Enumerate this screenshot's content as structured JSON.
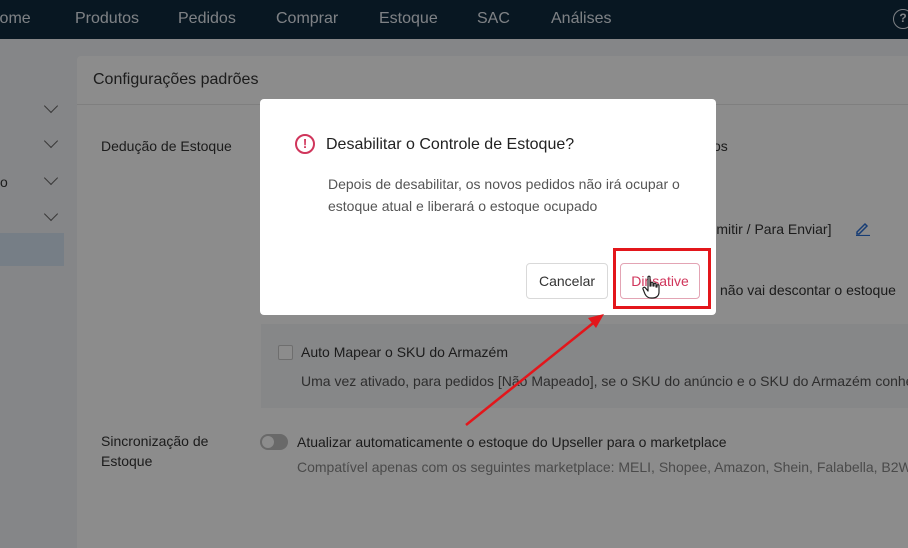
{
  "nav": {
    "items": [
      "Home",
      "Produtos",
      "Pedidos",
      "Comprar",
      "Estoque",
      "SAC",
      "Análises"
    ],
    "help": "?"
  },
  "sidebar": {
    "partial_label": "o"
  },
  "card": {
    "title": "Configurações padrões",
    "deduction_label": "Dedução de Estoque",
    "partial_right_1": "os",
    "partial_right_2": "Emitir / Para Enviar]",
    "partial_right_3": "não vai descontar o estoque",
    "auto_map_label": "Auto Mapear o SKU do Armazém",
    "auto_map_desc": "Uma vez ativado, para pedidos [Não Mapeado], se o SKU do anúncio e o SKU do Armazém conhe",
    "sync_label": "Sincronização de Estoque",
    "sync_toggle_label": "Atualizar automaticamente o estoque do Upseller para o marketplace",
    "sync_desc": "Compatível apenas com os seguintes marketplace: MELI, Shopee, Amazon, Shein, Falabella, B2W"
  },
  "modal": {
    "title": "Desabilitar o Controle de Estoque?",
    "body": "Depois de desabilitar, os novos pedidos não irá ocupar o estoque atual e liberará o estoque ocupado",
    "cancel_label": "Cancelar",
    "deactivate_label": "Dinsative"
  },
  "colors": {
    "nav_bg": "#0f2a3f",
    "accent_red": "#d0355b",
    "annotation_red": "#e3161b",
    "link_blue": "#2b6fd6"
  }
}
